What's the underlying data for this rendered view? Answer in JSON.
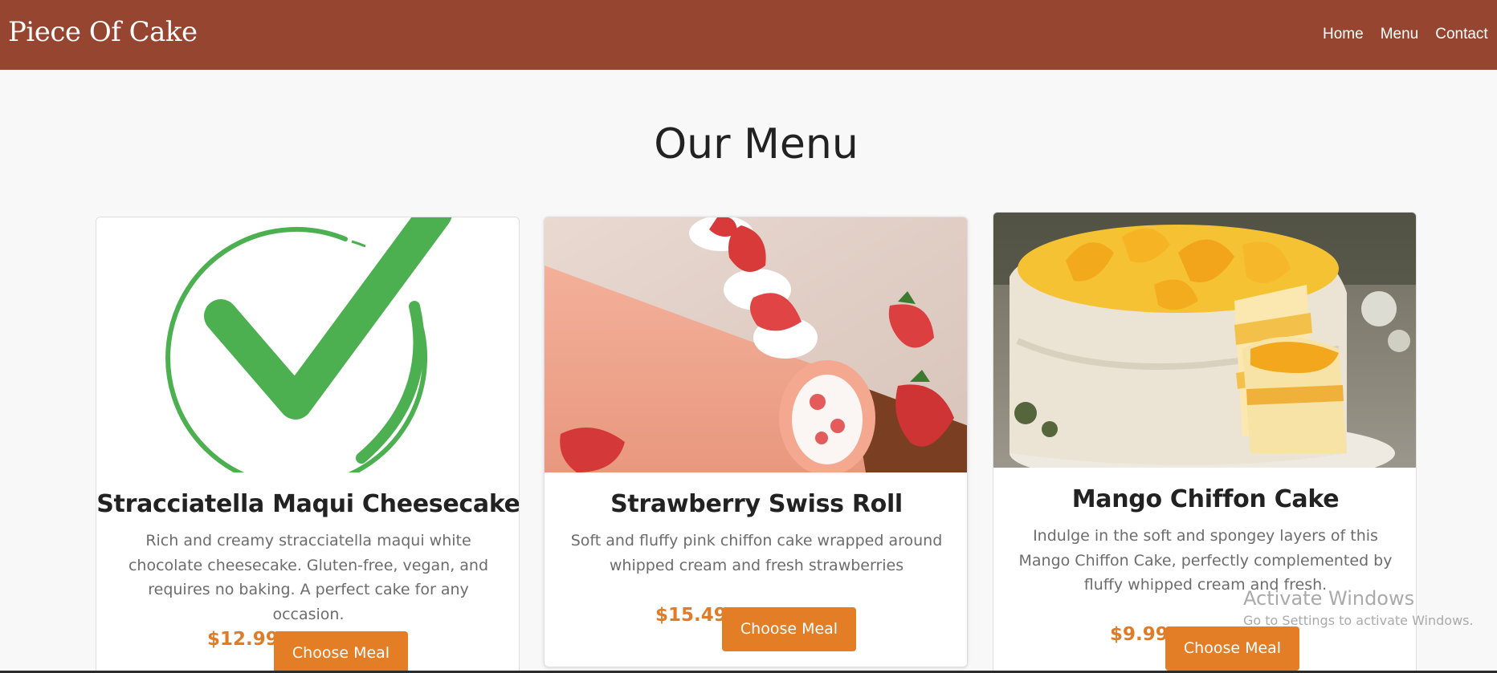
{
  "brand": "Piece Of Cake",
  "nav": [
    "Home",
    "Menu",
    "Contact"
  ],
  "page_title": "Our Menu",
  "colors": {
    "navbar": "#954530",
    "accent": "#e37e26",
    "price": "#e07b28"
  },
  "cards": [
    {
      "image": "green-checkmark-icon",
      "title": "Stracciatella Maqui Cheesecake",
      "description": "Rich and creamy stracciatella maqui white chocolate cheesecake. Gluten-free, vegan, and requires no baking. A perfect cake for any occasion.",
      "price": "$12.99",
      "button": "Choose Meal"
    },
    {
      "image": "strawberry-swiss-roll-photo",
      "title": "Strawberry Swiss Roll",
      "description": "Soft and fluffy pink chiffon cake wrapped around whipped cream and fresh strawberries",
      "price": "$15.49",
      "button": "Choose Meal"
    },
    {
      "image": "mango-chiffon-cake-photo",
      "title": "Mango Chiffon Cake",
      "description": "Indulge in the soft and spongey layers of this Mango Chiffon Cake, perfectly complemented by fluffy whipped cream and fresh.",
      "price": "$9.99",
      "button": "Choose Meal"
    }
  ],
  "watermark": {
    "title": "Activate Windows",
    "subtitle": "Go to Settings to activate Windows."
  }
}
